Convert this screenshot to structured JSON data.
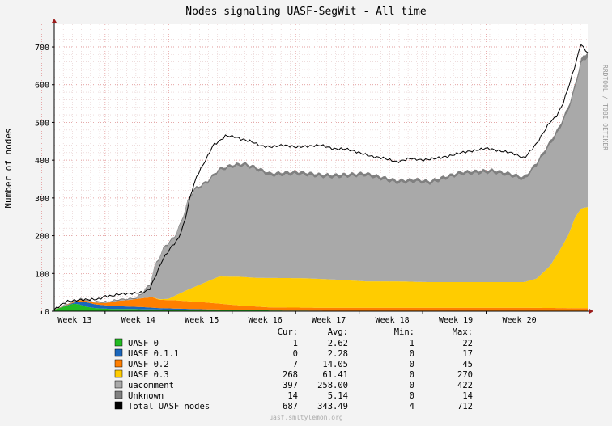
{
  "chart_data": {
    "type": "area",
    "stacked": true,
    "title": "Nodes signaling UASF-SegWit - All time",
    "ylabel": "Number of nodes",
    "xlabel": "",
    "ylim": [
      0,
      760
    ],
    "yticks": [
      0,
      100,
      200,
      300,
      400,
      500,
      600,
      700
    ],
    "x_range_weeks": [
      12.6,
      21.0
    ],
    "xticks": [
      {
        "label": "Week 13",
        "week": 13.0
      },
      {
        "label": "Week 14",
        "week": 14.0
      },
      {
        "label": "Week 15",
        "week": 15.0
      },
      {
        "label": "Week 16",
        "week": 16.0
      },
      {
        "label": "Week 17",
        "week": 17.0
      },
      {
        "label": "Week 18",
        "week": 18.0
      },
      {
        "label": "Week 19",
        "week": 19.0
      },
      {
        "label": "Week 20",
        "week": 20.0
      }
    ],
    "grid": true,
    "side_label": "RRDTOOL / TOBI OETIKER",
    "footer": "uasf.smltylemon.org",
    "stats_headers": [
      "Cur:",
      "Avg:",
      "Min:",
      "Max:"
    ],
    "series": [
      {
        "name": "UASF 0",
        "color": "#22bb22",
        "cur": "1",
        "avg": "2.62",
        "min": "1",
        "max": "22",
        "points": [
          [
            12.6,
            4
          ],
          [
            12.75,
            12
          ],
          [
            12.9,
            20
          ],
          [
            13.0,
            18
          ],
          [
            13.1,
            12
          ],
          [
            13.25,
            8
          ],
          [
            13.5,
            6
          ],
          [
            13.8,
            6
          ],
          [
            14.0,
            5
          ],
          [
            14.5,
            4
          ],
          [
            15.0,
            3
          ],
          [
            16.0,
            2
          ],
          [
            17.0,
            1
          ],
          [
            18.0,
            1
          ],
          [
            19.0,
            1
          ],
          [
            20.0,
            1
          ],
          [
            20.9,
            1
          ],
          [
            21.0,
            1
          ]
        ]
      },
      {
        "name": "UASF 0.1.1",
        "color": "#1a66bb",
        "cur": "0",
        "avg": "2.28",
        "min": "0",
        "max": "17",
        "points": [
          [
            12.6,
            0
          ],
          [
            12.9,
            2
          ],
          [
            13.0,
            8
          ],
          [
            13.1,
            12
          ],
          [
            13.25,
            10
          ],
          [
            13.5,
            8
          ],
          [
            13.8,
            6
          ],
          [
            14.0,
            6
          ],
          [
            14.2,
            4
          ],
          [
            14.5,
            3
          ],
          [
            15.0,
            2
          ],
          [
            15.5,
            1
          ],
          [
            16.0,
            0
          ],
          [
            17.0,
            0
          ],
          [
            18.0,
            0
          ],
          [
            19.0,
            0
          ],
          [
            20.0,
            0
          ],
          [
            21.0,
            0
          ]
        ]
      },
      {
        "name": "UASF 0.2",
        "color": "#ff7f00",
        "cur": "7",
        "avg": "14.05",
        "min": "0",
        "max": "45",
        "points": [
          [
            12.6,
            0
          ],
          [
            12.9,
            2
          ],
          [
            13.0,
            4
          ],
          [
            13.2,
            4
          ],
          [
            13.4,
            6
          ],
          [
            13.6,
            14
          ],
          [
            13.8,
            18
          ],
          [
            14.0,
            24
          ],
          [
            14.15,
            28
          ],
          [
            14.25,
            22
          ],
          [
            14.5,
            22
          ],
          [
            15.0,
            18
          ],
          [
            15.5,
            12
          ],
          [
            16.0,
            8
          ],
          [
            16.5,
            8
          ],
          [
            17.0,
            8
          ],
          [
            18.0,
            8
          ],
          [
            19.0,
            8
          ],
          [
            20.0,
            8
          ],
          [
            20.9,
            7
          ],
          [
            21.0,
            7
          ]
        ]
      },
      {
        "name": "UASF 0.3",
        "color": "#ffcc00",
        "cur": "268",
        "avg": "61.41",
        "min": "0",
        "max": "270",
        "points": [
          [
            12.6,
            0
          ],
          [
            14.1,
            0
          ],
          [
            14.4,
            3
          ],
          [
            14.7,
            30
          ],
          [
            15.0,
            55
          ],
          [
            15.2,
            72
          ],
          [
            15.5,
            76
          ],
          [
            15.8,
            76
          ],
          [
            16.0,
            78
          ],
          [
            16.5,
            78
          ],
          [
            17.0,
            75
          ],
          [
            17.5,
            70
          ],
          [
            18.0,
            70
          ],
          [
            18.5,
            68
          ],
          [
            19.0,
            68
          ],
          [
            19.5,
            68
          ],
          [
            20.0,
            68
          ],
          [
            20.2,
            78
          ],
          [
            20.4,
            110
          ],
          [
            20.55,
            150
          ],
          [
            20.7,
            195
          ],
          [
            20.8,
            240
          ],
          [
            20.9,
            265
          ],
          [
            21.0,
            268
          ]
        ]
      },
      {
        "name": "uacomment",
        "color": "#a9a9a9",
        "cur": "397",
        "avg": "258.00",
        "min": "0",
        "max": "422",
        "points": [
          [
            12.6,
            0
          ],
          [
            13.9,
            0
          ],
          [
            14.1,
            30
          ],
          [
            14.2,
            90
          ],
          [
            14.35,
            140
          ],
          [
            14.5,
            155
          ],
          [
            14.6,
            185
          ],
          [
            14.7,
            230
          ],
          [
            14.8,
            255
          ],
          [
            15.0,
            260
          ],
          [
            15.2,
            280
          ],
          [
            15.4,
            290
          ],
          [
            15.6,
            295
          ],
          [
            15.8,
            285
          ],
          [
            16.0,
            270
          ],
          [
            16.4,
            275
          ],
          [
            16.8,
            270
          ],
          [
            17.0,
            270
          ],
          [
            17.5,
            280
          ],
          [
            18.0,
            260
          ],
          [
            18.3,
            265
          ],
          [
            18.5,
            260
          ],
          [
            19.0,
            285
          ],
          [
            19.5,
            290
          ],
          [
            19.8,
            280
          ],
          [
            20.0,
            270
          ],
          [
            20.2,
            300
          ],
          [
            20.4,
            320
          ],
          [
            20.55,
            320
          ],
          [
            20.7,
            330
          ],
          [
            20.8,
            340
          ],
          [
            20.9,
            385
          ],
          [
            21.0,
            397
          ]
        ]
      },
      {
        "name": "Unknown",
        "color": "#808080",
        "cur": "14",
        "avg": "5.14",
        "min": "0",
        "max": "14",
        "points": [
          [
            12.6,
            0
          ],
          [
            13.0,
            2
          ],
          [
            14.0,
            3
          ],
          [
            15.0,
            6
          ],
          [
            16.0,
            8
          ],
          [
            17.0,
            8
          ],
          [
            18.0,
            8
          ],
          [
            19.0,
            8
          ],
          [
            20.0,
            8
          ],
          [
            20.9,
            12
          ],
          [
            21.0,
            14
          ]
        ]
      }
    ],
    "total": {
      "name": "Total UASF nodes",
      "color": "#000000",
      "cur": "687",
      "avg": "343.49",
      "min": "4",
      "max": "712",
      "points": [
        [
          12.6,
          4
        ],
        [
          12.7,
          16
        ],
        [
          12.8,
          26
        ],
        [
          13.0,
          30
        ],
        [
          13.15,
          31
        ],
        [
          13.3,
          32
        ],
        [
          13.4,
          40
        ],
        [
          13.5,
          40
        ],
        [
          13.6,
          45
        ],
        [
          13.8,
          47
        ],
        [
          14.0,
          50
        ],
        [
          14.1,
          58
        ],
        [
          14.2,
          95
        ],
        [
          14.3,
          135
        ],
        [
          14.45,
          172
        ],
        [
          14.55,
          190
        ],
        [
          14.65,
          235
        ],
        [
          14.75,
          310
        ],
        [
          14.85,
          360
        ],
        [
          15.0,
          405
        ],
        [
          15.1,
          440
        ],
        [
          15.2,
          450
        ],
        [
          15.3,
          465
        ],
        [
          15.45,
          462
        ],
        [
          15.55,
          455
        ],
        [
          15.7,
          450
        ],
        [
          15.85,
          438
        ],
        [
          16.0,
          435
        ],
        [
          16.2,
          440
        ],
        [
          16.4,
          435
        ],
        [
          16.6,
          437
        ],
        [
          16.8,
          440
        ],
        [
          17.0,
          430
        ],
        [
          17.2,
          430
        ],
        [
          17.4,
          420
        ],
        [
          17.6,
          410
        ],
        [
          17.8,
          405
        ],
        [
          18.0,
          395
        ],
        [
          18.2,
          405
        ],
        [
          18.4,
          400
        ],
        [
          18.6,
          405
        ],
        [
          18.8,
          410
        ],
        [
          19.0,
          420
        ],
        [
          19.2,
          425
        ],
        [
          19.4,
          432
        ],
        [
          19.6,
          425
        ],
        [
          19.8,
          420
        ],
        [
          20.0,
          405
        ],
        [
          20.2,
          445
        ],
        [
          20.4,
          500
        ],
        [
          20.5,
          515
        ],
        [
          20.6,
          545
        ],
        [
          20.7,
          595
        ],
        [
          20.8,
          650
        ],
        [
          20.9,
          712
        ],
        [
          20.95,
          690
        ],
        [
          21.0,
          687
        ]
      ]
    }
  }
}
